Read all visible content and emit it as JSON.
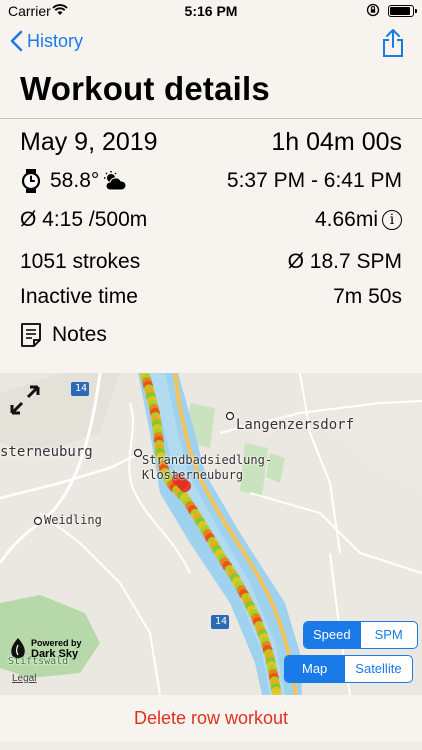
{
  "status_bar": {
    "carrier": "Carrier",
    "time": "5:16 PM"
  },
  "nav": {
    "back_label": "History"
  },
  "page_title": "Workout details",
  "details": {
    "date": "May 9, 2019",
    "duration": "1h 04m 00s",
    "temperature": "58.8°",
    "time_range": "5:37 PM - 6:41 PM",
    "avg_pace": "Ø 4:15 /500m",
    "distance": "4.66mi",
    "strokes": "1051 strokes",
    "avg_spm": "Ø 18.7 SPM",
    "inactive_label": "Inactive time",
    "inactive_value": "7m 50s",
    "notes_label": "Notes"
  },
  "map": {
    "labels": {
      "place1": "Langenzersdorf",
      "place2": "sterneuburg",
      "place3": "Strandbadsiedlung-",
      "place4": "Klosterneuburg",
      "place5": "Weidling",
      "place6": "Stiftswald",
      "road1": "14",
      "road2": "14"
    },
    "metric_segment": {
      "options": [
        "Speed",
        "SPM"
      ],
      "selected": "Speed"
    },
    "maptype_segment": {
      "options": [
        "Map",
        "Satellite"
      ],
      "selected": "Map"
    },
    "attribution": {
      "line1": "Powered by",
      "line2": "Dark Sky"
    },
    "legal": "Legal"
  },
  "actions": {
    "delete_label": "Delete row workout"
  },
  "colors": {
    "accent": "#1a7ae8",
    "destructive": "#e0301e",
    "river": "#9fd2ee"
  }
}
